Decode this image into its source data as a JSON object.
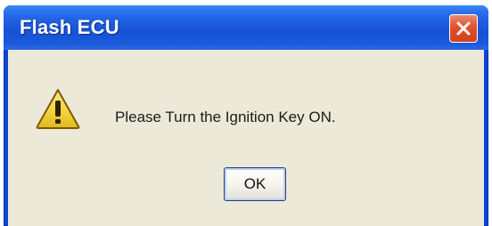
{
  "window": {
    "title": "Flash ECU"
  },
  "dialog": {
    "icon": "warning-icon",
    "message": "Please Turn the Ignition Key ON.",
    "ok_label": "OK"
  },
  "colors": {
    "titlebar_blue": "#1852d6",
    "client_background": "#ece9d8",
    "close_button_red": "#e0512d",
    "warning_yellow": "#f2d23c"
  }
}
